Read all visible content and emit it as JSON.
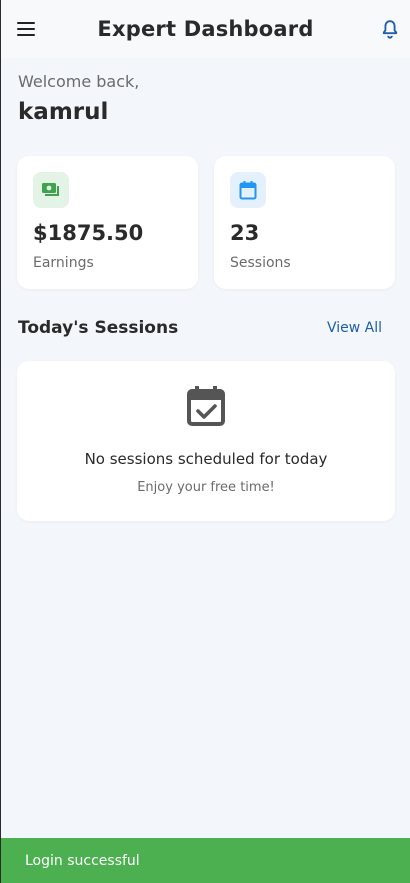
{
  "appbar": {
    "title": "Expert Dashboard",
    "menu_icon": "menu-icon",
    "bell_icon": "bell-icon"
  },
  "welcome": {
    "greeting": "Welcome back,",
    "name": "kamrul"
  },
  "stats": [
    {
      "icon": "money-icon",
      "value": "$1875.50",
      "label": "Earnings",
      "icon_color": "#3fa34d",
      "icon_bg": "#e3f3e5"
    },
    {
      "icon": "calendar-icon",
      "value": "23",
      "label": "Sessions",
      "icon_color": "#2196f3",
      "icon_bg": "#e4f1fd"
    }
  ],
  "sessions": {
    "title": "Today's Sessions",
    "view_all": "View All",
    "empty_icon": "calendar-check-icon",
    "empty_message": "No sessions scheduled for today",
    "empty_sub": "Enjoy your free time!"
  },
  "snackbar": {
    "message": "Login successful",
    "color": "#4caf50"
  },
  "colors": {
    "accent": "#1d5fa8",
    "background": "#f3f6fa"
  }
}
